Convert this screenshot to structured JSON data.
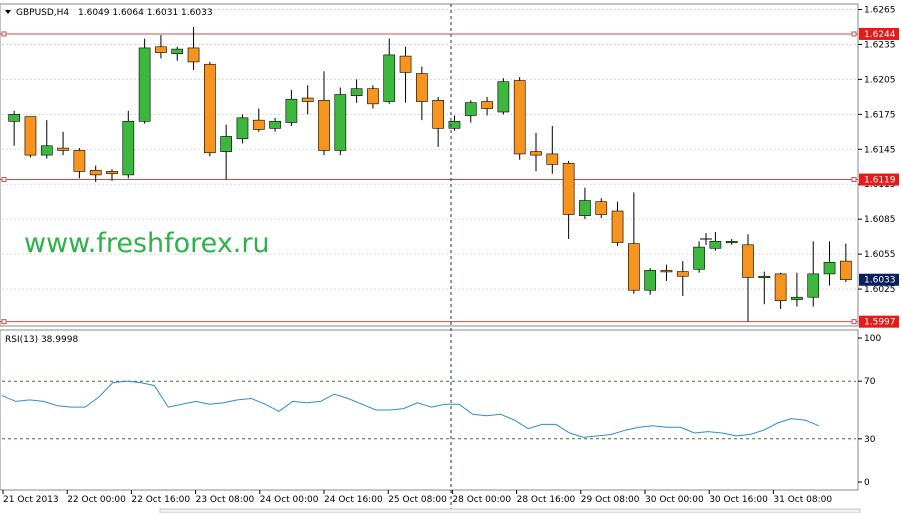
{
  "header": {
    "symbol": "GBPUSD,H4",
    "ohlc": "1.6049 1.6064 1.6031 1.6033",
    "rsi_label": "RSI(13) 38.9998"
  },
  "watermark": "www.freshforex.ru",
  "colors": {
    "bull": "#3cb83c",
    "bear": "#f7941d",
    "hline": "#c0504d",
    "hline_tag_bg": "#e31b1b",
    "price_tag_bg": "#0b1f5c",
    "grid": "#d9d9d9",
    "rsi_line": "#2f8bd0",
    "rsi_level": "#2f7d2f"
  },
  "price_axis": {
    "ticks": [
      "1.6265",
      "1.6235",
      "1.6205",
      "1.6175",
      "1.6145",
      "1.6115",
      "1.6085",
      "1.6055",
      "1.6025"
    ]
  },
  "rsi_axis": {
    "ticks": [
      "100",
      "70",
      "30",
      "0"
    ]
  },
  "time_axis": {
    "labels": [
      "21 Oct 2013",
      "22 Oct 00:00",
      "22 Oct 16:00",
      "23 Oct 08:00",
      "24 Oct 00:00",
      "24 Oct 16:00",
      "25 Oct 08:00",
      "28 Oct 00:00",
      "28 Oct 16:00",
      "29 Oct 08:00",
      "30 Oct 00:00",
      "30 Oct 16:00",
      "31 Oct 08:00"
    ]
  },
  "price_tags": {
    "upper": "1.6244",
    "middle": "1.6119",
    "lower": "1.5997",
    "current": "1.6033"
  },
  "chart_data": {
    "type": "candlestick",
    "title": "GBPUSD,H4",
    "ylim": [
      1.5995,
      1.6268
    ],
    "horizontal_lines": [
      1.6244,
      1.6119,
      1.5997
    ],
    "current_price": 1.6033,
    "ohlc": [
      {
        "o": 1.6169,
        "h": 1.6178,
        "l": 1.6148,
        "c": 1.6175
      },
      {
        "o": 1.6173,
        "h": 1.6173,
        "l": 1.6138,
        "c": 1.614
      },
      {
        "o": 1.614,
        "h": 1.617,
        "l": 1.6137,
        "c": 1.6148
      },
      {
        "o": 1.6146,
        "h": 1.616,
        "l": 1.614,
        "c": 1.6144
      },
      {
        "o": 1.6144,
        "h": 1.6146,
        "l": 1.612,
        "c": 1.6126
      },
      {
        "o": 1.6127,
        "h": 1.6131,
        "l": 1.6117,
        "c": 1.6123
      },
      {
        "o": 1.6126,
        "h": 1.6128,
        "l": 1.6118,
        "c": 1.6124
      },
      {
        "o": 1.6123,
        "h": 1.6178,
        "l": 1.612,
        "c": 1.6169
      },
      {
        "o": 1.6169,
        "h": 1.624,
        "l": 1.6167,
        "c": 1.6232
      },
      {
        "o": 1.6233,
        "h": 1.6243,
        "l": 1.6223,
        "c": 1.6228
      },
      {
        "o": 1.6227,
        "h": 1.6233,
        "l": 1.6221,
        "c": 1.6231
      },
      {
        "o": 1.6232,
        "h": 1.625,
        "l": 1.6213,
        "c": 1.622
      },
      {
        "o": 1.6218,
        "h": 1.622,
        "l": 1.6139,
        "c": 1.6142
      },
      {
        "o": 1.6143,
        "h": 1.6166,
        "l": 1.6119,
        "c": 1.6156
      },
      {
        "o": 1.6154,
        "h": 1.6175,
        "l": 1.615,
        "c": 1.6172
      },
      {
        "o": 1.617,
        "h": 1.618,
        "l": 1.616,
        "c": 1.6162
      },
      {
        "o": 1.6163,
        "h": 1.6172,
        "l": 1.616,
        "c": 1.6169
      },
      {
        "o": 1.6168,
        "h": 1.6196,
        "l": 1.6165,
        "c": 1.6188
      },
      {
        "o": 1.6189,
        "h": 1.62,
        "l": 1.6175,
        "c": 1.6186
      },
      {
        "o": 1.6187,
        "h": 1.6212,
        "l": 1.614,
        "c": 1.6144
      },
      {
        "o": 1.6144,
        "h": 1.6198,
        "l": 1.614,
        "c": 1.6192
      },
      {
        "o": 1.6191,
        "h": 1.6205,
        "l": 1.6185,
        "c": 1.6197
      },
      {
        "o": 1.6197,
        "h": 1.62,
        "l": 1.618,
        "c": 1.6184
      },
      {
        "o": 1.6186,
        "h": 1.624,
        "l": 1.6184,
        "c": 1.6226
      },
      {
        "o": 1.6225,
        "h": 1.6233,
        "l": 1.6185,
        "c": 1.6211
      },
      {
        "o": 1.621,
        "h": 1.6216,
        "l": 1.617,
        "c": 1.6186
      },
      {
        "o": 1.6187,
        "h": 1.619,
        "l": 1.6147,
        "c": 1.6163
      },
      {
        "o": 1.6163,
        "h": 1.6174,
        "l": 1.6161,
        "c": 1.6169
      },
      {
        "o": 1.6174,
        "h": 1.6187,
        "l": 1.6168,
        "c": 1.6185
      },
      {
        "o": 1.6186,
        "h": 1.619,
        "l": 1.6174,
        "c": 1.618
      },
      {
        "o": 1.6177,
        "h": 1.6206,
        "l": 1.6175,
        "c": 1.6203
      },
      {
        "o": 1.6204,
        "h": 1.6207,
        "l": 1.6136,
        "c": 1.6141
      },
      {
        "o": 1.6143,
        "h": 1.6159,
        "l": 1.6126,
        "c": 1.614
      },
      {
        "o": 1.6141,
        "h": 1.6165,
        "l": 1.6124,
        "c": 1.6132
      },
      {
        "o": 1.6133,
        "h": 1.6135,
        "l": 1.6068,
        "c": 1.6089
      },
      {
        "o": 1.6088,
        "h": 1.6112,
        "l": 1.6085,
        "c": 1.6101
      },
      {
        "o": 1.61,
        "h": 1.6103,
        "l": 1.6086,
        "c": 1.6089
      },
      {
        "o": 1.6092,
        "h": 1.61,
        "l": 1.6062,
        "c": 1.6065
      },
      {
        "o": 1.6064,
        "h": 1.6108,
        "l": 1.6021,
        "c": 1.6024
      },
      {
        "o": 1.6024,
        "h": 1.6043,
        "l": 1.602,
        "c": 1.6041
      },
      {
        "o": 1.6041,
        "h": 1.6046,
        "l": 1.6032,
        "c": 1.604
      },
      {
        "o": 1.604,
        "h": 1.6049,
        "l": 1.6019,
        "c": 1.6036
      },
      {
        "o": 1.6042,
        "h": 1.6066,
        "l": 1.6039,
        "c": 1.6061
      },
      {
        "o": 1.606,
        "h": 1.6074,
        "l": 1.6058,
        "c": 1.6066
      },
      {
        "o": 1.6066,
        "h": 1.6068,
        "l": 1.6063,
        "c": 1.6066
      },
      {
        "o": 1.6063,
        "h": 1.6072,
        "l": 1.5997,
        "c": 1.6035
      },
      {
        "o": 1.6035,
        "h": 1.604,
        "l": 1.6012,
        "c": 1.6036
      },
      {
        "o": 1.6038,
        "h": 1.6039,
        "l": 1.6008,
        "c": 1.6015
      },
      {
        "o": 1.6016,
        "h": 1.6039,
        "l": 1.601,
        "c": 1.6018
      },
      {
        "o": 1.6018,
        "h": 1.6066,
        "l": 1.601,
        "c": 1.6038
      },
      {
        "o": 1.6038,
        "h": 1.6066,
        "l": 1.6028,
        "c": 1.6048
      },
      {
        "o": 1.6049,
        "h": 1.6064,
        "l": 1.6031,
        "c": 1.6033
      }
    ],
    "rsi": {
      "name": "RSI(13)",
      "last": 38.9998,
      "levels": [
        70,
        30
      ],
      "ylim": [
        0,
        100
      ],
      "values": [
        60,
        56,
        57,
        56,
        53,
        52,
        52,
        59,
        69,
        70,
        69,
        67,
        52,
        54,
        56,
        54,
        55,
        57,
        58,
        54,
        49,
        56,
        55,
        56,
        61,
        58,
        54,
        50,
        50,
        51,
        55,
        52,
        54,
        54,
        47,
        46,
        47,
        43,
        37,
        40,
        40,
        34,
        31,
        32,
        33,
        36,
        38,
        39,
        38,
        38,
        34,
        35,
        34,
        32,
        33,
        36,
        41,
        44,
        43,
        39
      ]
    }
  }
}
